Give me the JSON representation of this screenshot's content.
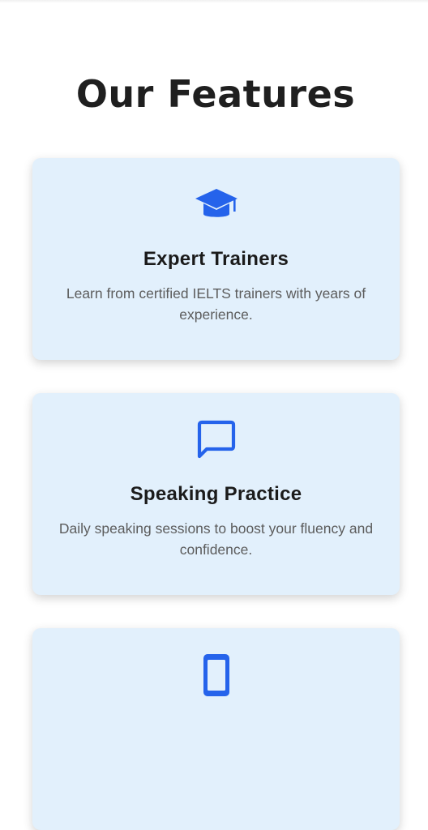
{
  "section": {
    "title": "Our Features"
  },
  "colors": {
    "accent": "#2563eb",
    "card_bg": "#e2f0fc",
    "title": "#1f1f1f",
    "body_text": "#5c5c5c"
  },
  "features": [
    {
      "icon": "graduation-cap-icon",
      "title": "Expert Trainers",
      "description": "Learn from certified IELTS trainers with years of experience."
    },
    {
      "icon": "chat-bubble-icon",
      "title": "Speaking Practice",
      "description": "Daily speaking sessions to boost your fluency and confidence."
    },
    {
      "icon": "smartphone-icon",
      "title": "",
      "description": ""
    }
  ]
}
